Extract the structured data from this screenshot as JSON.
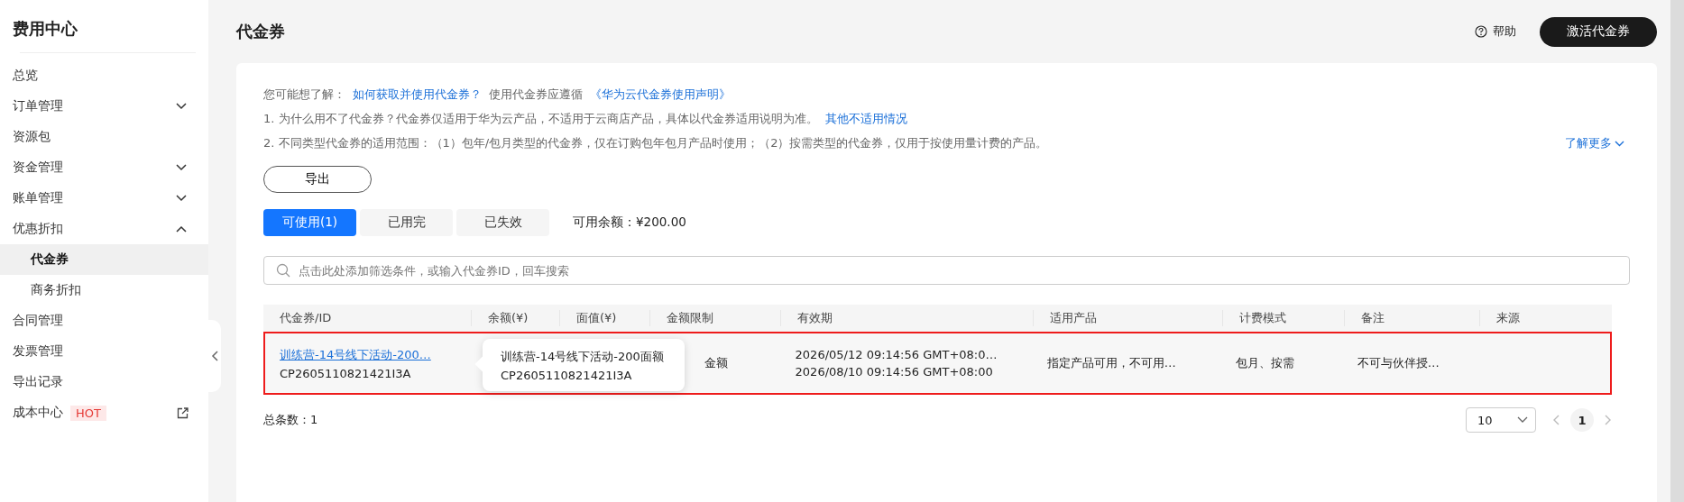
{
  "sidebar": {
    "title": "费用中心",
    "items": [
      {
        "label": "总览",
        "selected": false
      },
      {
        "label": "订单管理",
        "selected": false,
        "expanded": false
      },
      {
        "label": "资源包",
        "selected": false
      },
      {
        "label": "资金管理",
        "selected": false,
        "expanded": false
      },
      {
        "label": "账单管理",
        "selected": false,
        "expanded": false
      },
      {
        "label": "优惠折扣",
        "selected": false,
        "expanded": true,
        "children": [
          {
            "label": "代金券",
            "selected": true
          },
          {
            "label": "商务折扣",
            "selected": false
          }
        ]
      },
      {
        "label": "合同管理",
        "selected": false
      },
      {
        "label": "发票管理",
        "selected": false
      },
      {
        "label": "导出记录",
        "selected": false
      },
      {
        "label": "成本中心",
        "selected": false,
        "badge": "HOT",
        "external": true
      }
    ]
  },
  "header": {
    "title": "代金券",
    "help": "帮助",
    "primary_button": "激活代金券"
  },
  "notice": {
    "lead": "您可能想了解：",
    "link1": "如何获取并使用代金券？",
    "mid": "使用代金券应遵循",
    "link2": "《华为云代金券使用声明》",
    "line1": "1. 为什么用不了代金券？代金券仅适用于华为云产品，不适用于云商店产品，具体以代金券适用说明为准。",
    "line1_link": "其他不适用情况",
    "line2": "2. 不同类型代金券的适用范围：（1）包年/包月类型的代金券，仅在订购包年包月产品时使用；（2）按需类型的代金券，仅用于按使用量计费的产品。",
    "more": "了解更多"
  },
  "export_button": "导出",
  "tabs": [
    {
      "label": "可使用(1)",
      "selected": true
    },
    {
      "label": "已用完",
      "selected": false
    },
    {
      "label": "已失效",
      "selected": false
    }
  ],
  "balance": "可用余额：¥200.00",
  "search": {
    "placeholder": "点击此处添加筛选条件，或输入代金券ID，回车搜索"
  },
  "table": {
    "columns": [
      "代金券/ID",
      "余额(¥)",
      "面值(¥)",
      "金额限制",
      "有效期",
      "适用产品",
      "计费模式",
      "备注",
      "来源"
    ],
    "rows": [
      {
        "name": "训练营-14号线下活动-200…",
        "id": "CP2605110821421I3A",
        "amount_limit": "金额",
        "valid_from": "2026/05/12 09:14:56 GMT+08:0…",
        "valid_to": "2026/08/10 09:14:56 GMT+08:00",
        "products": "指定产品可用，不可用…",
        "billing": "包月、按需",
        "remark": "不可与伙伴授…",
        "highlighted": true
      }
    ]
  },
  "tooltip": {
    "title": "训练营-14号线下活动-200面额",
    "id": "CP2605110821421I3A"
  },
  "footer": {
    "total": "总条数：1",
    "page_size": "10",
    "page": "1"
  }
}
